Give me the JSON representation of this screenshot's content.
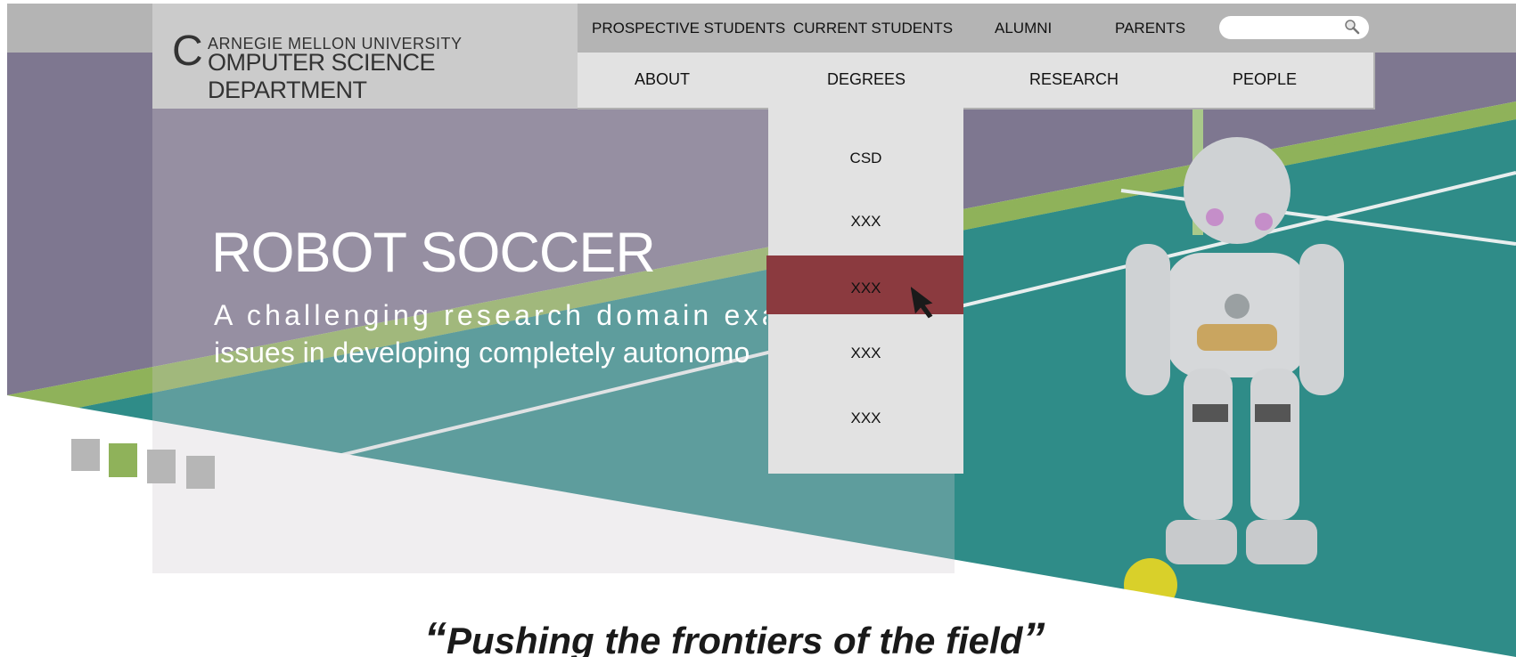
{
  "header": {
    "logo": {
      "initial": "C",
      "line1": "ARNEGIE MELLON UNIVERSITY",
      "line2": "OMPUTER SCIENCE DEPARTMENT"
    },
    "top_links": [
      "PROSPECTIVE STUDENTS",
      "CURRENT STUDENTS",
      "ALUMNI",
      "PARENTS"
    ],
    "search": {
      "placeholder": "",
      "icon": "search-icon"
    },
    "main_nav": [
      "ABOUT",
      "DEGREES",
      "RESEARCH",
      "PEOPLE"
    ]
  },
  "dropdown": {
    "parent": "DEGREES",
    "items": [
      "CSD",
      "XXX",
      "XXX",
      "XXX",
      "XXX"
    ],
    "active_index": 2,
    "active_color": "#8b3a3f"
  },
  "hero": {
    "title": "ROBOT SOCCER",
    "subtitle_line1": "A challenging research domain examinin",
    "subtitle_line2": "issues in developing completely autonomo",
    "image": "robot-soccer-photo"
  },
  "quote": {
    "open": "“",
    "text": "Pushing the frontiers of the field",
    "close": "”"
  },
  "colors": {
    "topbar": "#b4b4b4",
    "nav": "#e2e2e2",
    "logo_box": "#cbcbcb",
    "field": "#2f8c88",
    "wall": "#7e7790",
    "green_rail": "#8fb25a",
    "accent": "#8b3a3f"
  }
}
